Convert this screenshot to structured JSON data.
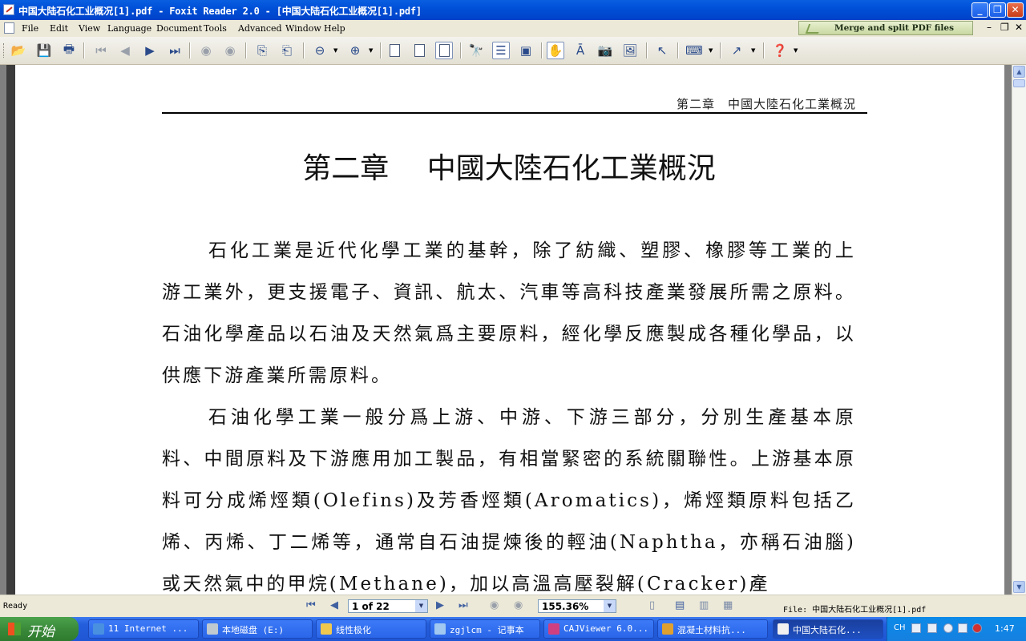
{
  "window": {
    "title": "中国大陆石化工业概况[1].pdf - Foxit Reader 2.0 - [中国大陆石化工业概况[1].pdf]"
  },
  "menu": [
    "File",
    "Edit",
    "View",
    "Language",
    "Document",
    "Tools",
    "Advanced",
    "Window",
    "Help"
  ],
  "merge_banner": "Merge and split PDF files",
  "document": {
    "running_header": "第二章　中國大陸石化工業概況",
    "chapter_title": "第二章　 中國大陸石化工業概況",
    "paragraphs": [
      "石化工業是近代化學工業的基幹，除了紡織、塑膠、橡膠等工業的上游工業外，更支援電子、資訊、航太、汽車等高科技產業發展所需之原料。石油化學產品以石油及天然氣爲主要原料，經化學反應製成各種化學品，以供應下游產業所需原料。",
      "石油化學工業一般分爲上游、中游、下游三部分，分別生產基本原料、中間原料及下游應用加工製品，有相當緊密的系統關聯性。上游基本原料可分成烯烴類(Olefins)及芳香烴類(Aromatics)，烯烴類原料包括乙烯、丙烯、丁二烯等，通常自石油提煉後的輕油(Naphtha，亦稱石油腦)或天然氣中的甲烷(Methane)，加以高溫高壓裂解(Cracker)產"
    ]
  },
  "statusbar": {
    "ready": "Ready",
    "page": "1 of 22",
    "zoom": "155.36%",
    "file": "File: 中国大陆石化工业概况[1].pdf"
  },
  "taskbar": {
    "start": "开始",
    "tasks": [
      "11 Internet ...",
      "本地磁盘 (E:)",
      "线性极化",
      "zgjlcm - 记事本",
      "CAJViewer 6.0...",
      "混凝土材料抗...",
      "中国大陆石化..."
    ],
    "lang": "CH",
    "clock": "1:47"
  },
  "colors": {
    "titlebar": "#0050d8",
    "taskbar": "#245edc",
    "start": "#3a8a3a"
  }
}
